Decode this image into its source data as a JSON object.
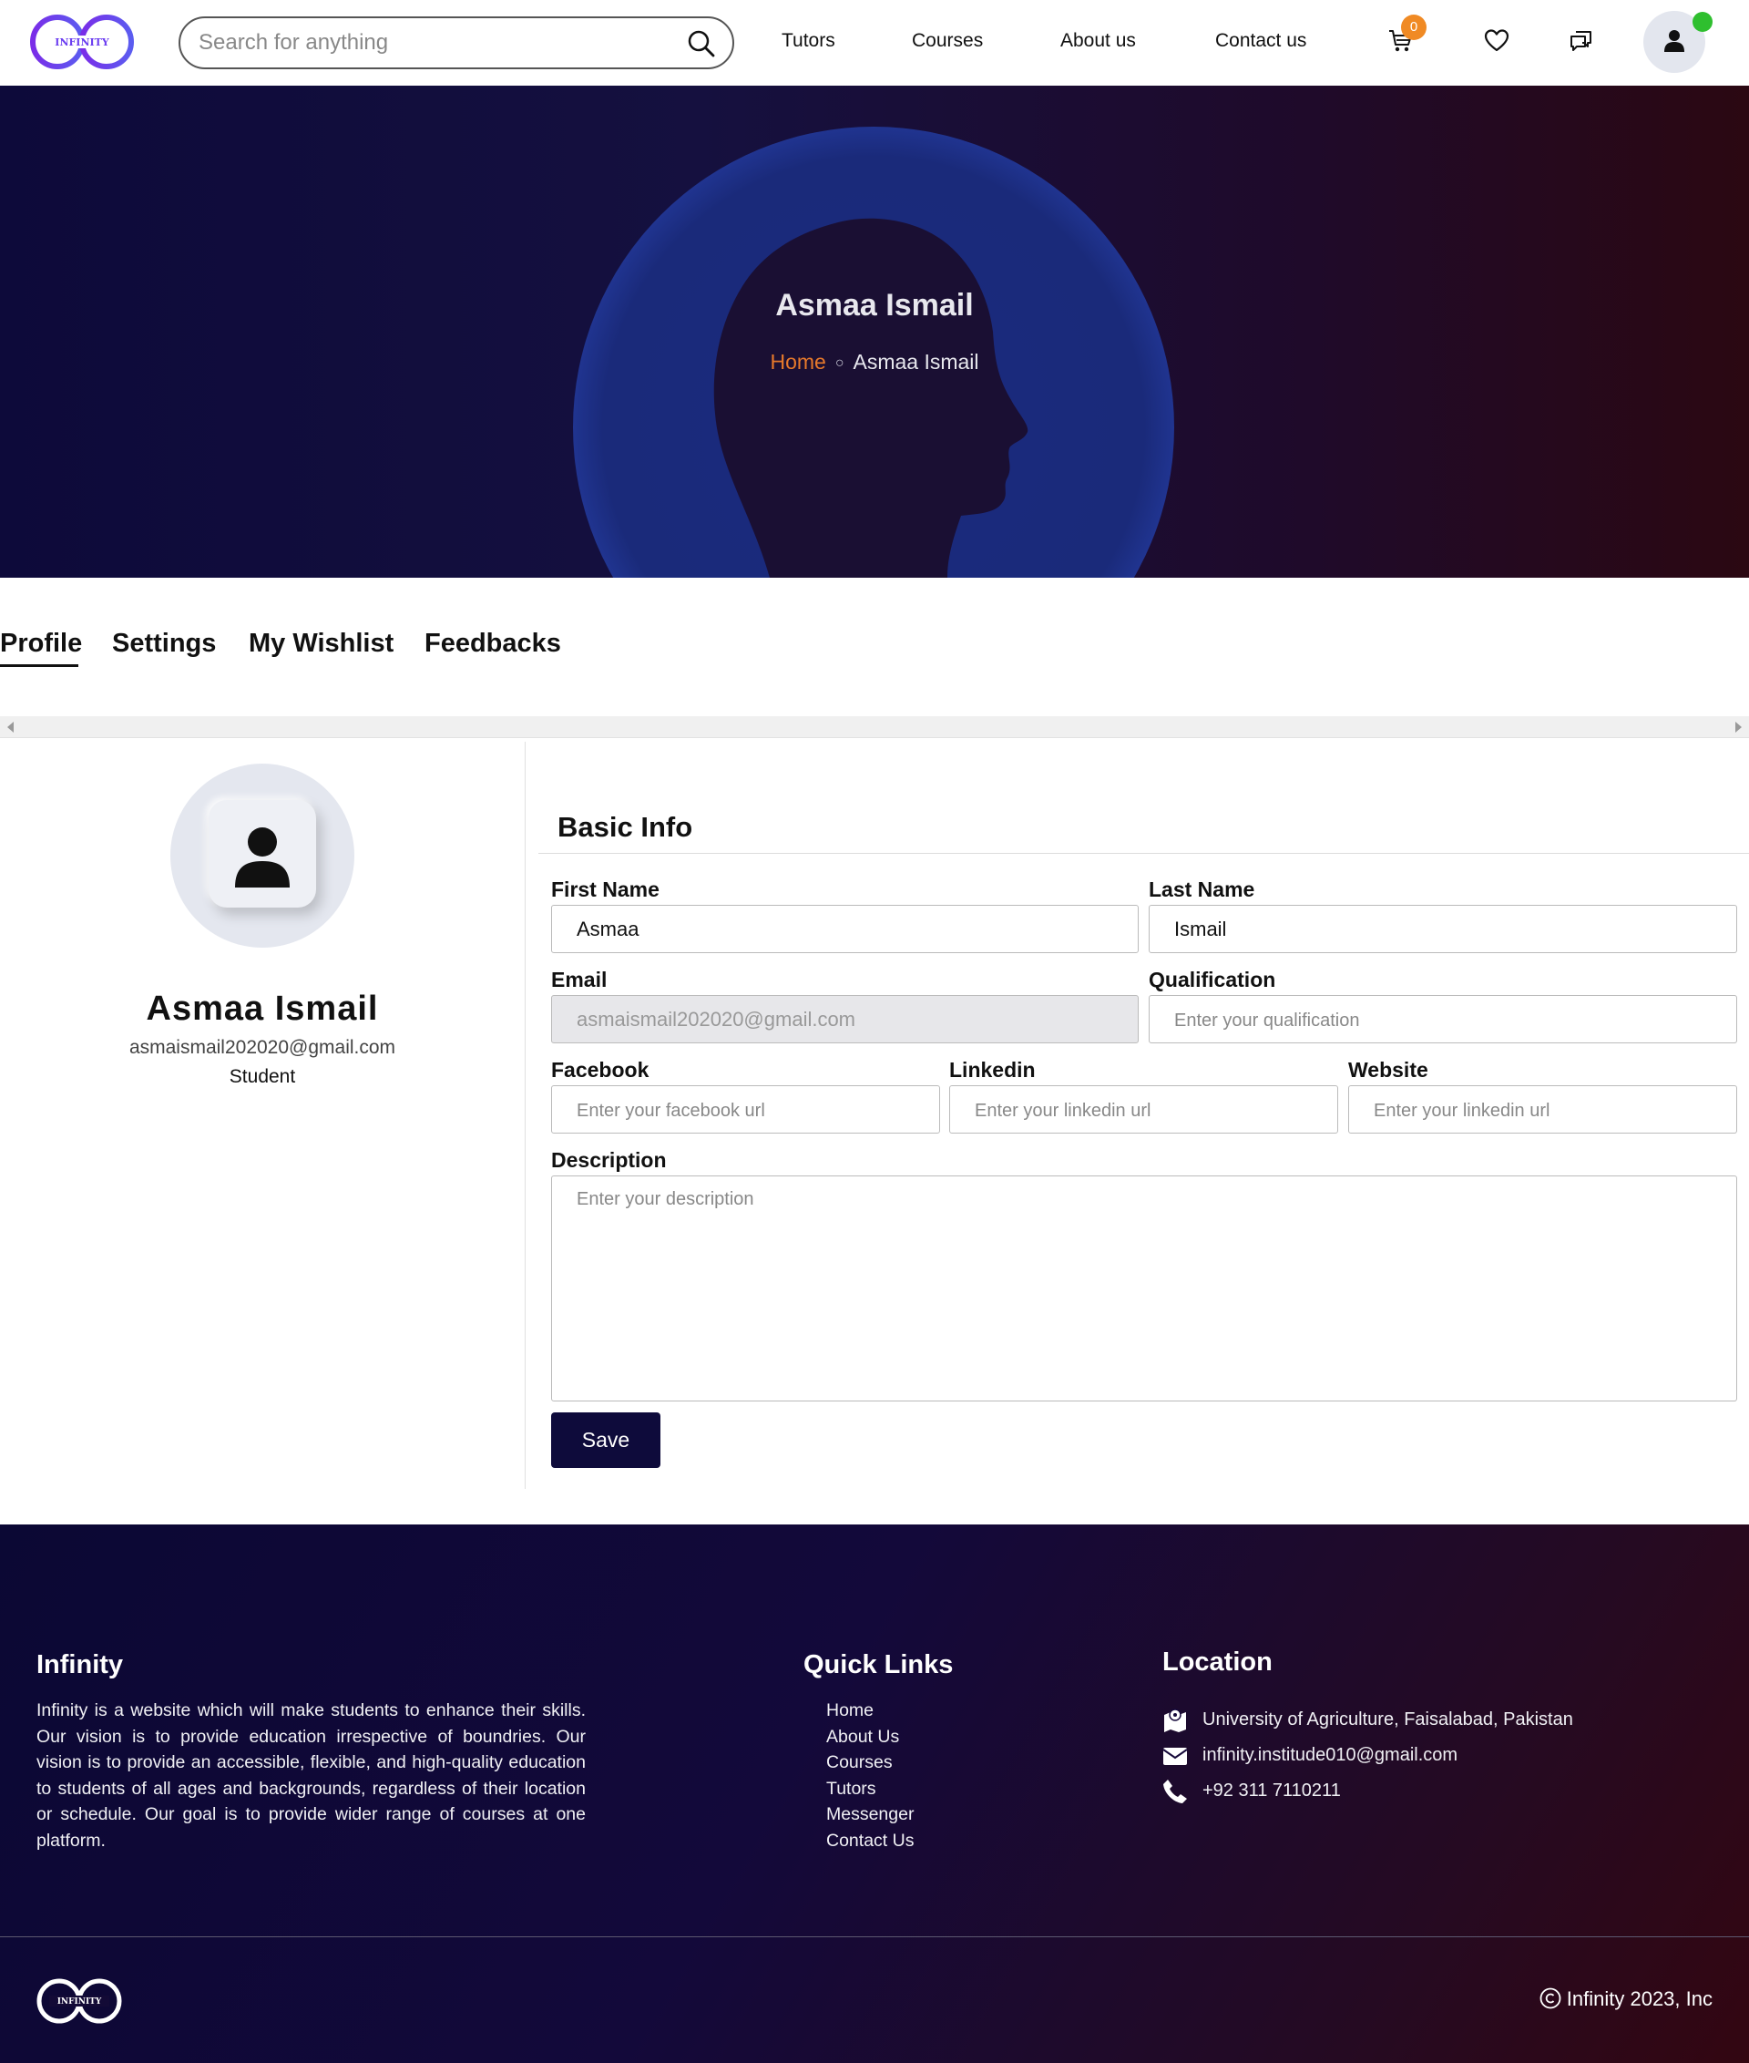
{
  "brand": {
    "logo_text": "INFINITY"
  },
  "search": {
    "placeholder": "Search for anything"
  },
  "nav": {
    "links": [
      "Tutors",
      "Courses",
      "About us",
      "Contact us"
    ],
    "cart_count": "0"
  },
  "hero": {
    "title": "Asmaa Ismail",
    "breadcrumb_home": "Home",
    "breadcrumb_current": "Asmaa Ismail"
  },
  "tabs": [
    "Profile",
    "Settings",
    "My Wishlist",
    "Feedbacks"
  ],
  "profile": {
    "name": "Asmaa Ismail",
    "email": "asmaismail202020@gmail.com",
    "role": "Student"
  },
  "form": {
    "title": "Basic Info",
    "first_name": {
      "label": "First Name",
      "value": "Asmaa"
    },
    "last_name": {
      "label": "Last Name",
      "value": "Ismail"
    },
    "email": {
      "label": "Email",
      "value": "asmaismail202020@gmail.com"
    },
    "qualification": {
      "label": "Qualification",
      "placeholder": "Enter your qualification"
    },
    "facebook": {
      "label": "Facebook",
      "placeholder": "Enter your facebook url"
    },
    "linkedin": {
      "label": "Linkedin",
      "placeholder": "Enter your linkedin url"
    },
    "website": {
      "label": "Website",
      "placeholder": "Enter your linkedin url"
    },
    "description": {
      "label": "Description",
      "placeholder": "Enter your description"
    },
    "save_label": "Save"
  },
  "footer": {
    "about_title": "Infinity",
    "about_text": "Infinity is a website which will make students to enhance their skills. Our vision is to provide education irrespective of boundries. Our vision is to provide an accessible, flexible, and high-quality education to students of all ages and backgrounds, regardless of their location or schedule. Our goal is to provide wider range of courses at one platform.",
    "links_title": "Quick Links",
    "links": [
      "Home",
      "About Us",
      "Courses",
      "Tutors",
      "Messenger",
      "Contact Us"
    ],
    "location_title": "Location",
    "address": "University of Agriculture, Faisalabad, Pakistan",
    "email": "infinity.institude010@gmail.com",
    "phone": "+92 311 7110211",
    "copyright": "Infinity 2023, Inc",
    "logo_text": "INFINITY"
  },
  "colors": {
    "accent_orange": "#e7792b",
    "brand_purple": "#6b3df0",
    "primary_navy": "#0e0b3b",
    "online_green": "#2fbf2f"
  },
  "icons": [
    "search-icon",
    "cart-icon",
    "heart-icon",
    "chat-icon",
    "user-icon",
    "map-icon",
    "mail-icon",
    "phone-icon",
    "copyright-icon"
  ]
}
